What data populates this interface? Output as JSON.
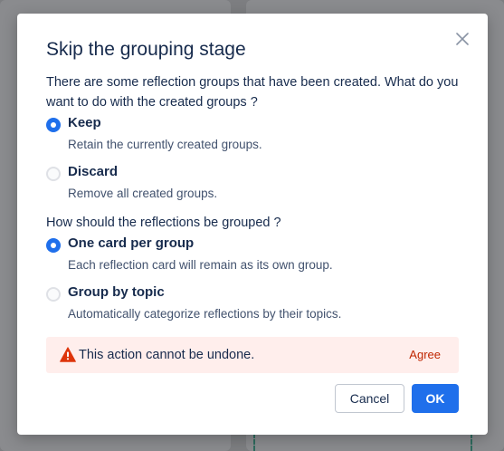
{
  "dialog": {
    "title": "Skip the grouping stage",
    "close_icon": "close-icon"
  },
  "question1": {
    "text": "There are some reflection groups that have been created. What do you want to do with the created groups ?",
    "options": [
      {
        "label": "Keep",
        "description": "Retain the currently created groups.",
        "selected": true
      },
      {
        "label": "Discard",
        "description": "Remove all created groups.",
        "selected": false
      }
    ]
  },
  "question2": {
    "text": "How should the reflections be grouped ?",
    "options": [
      {
        "label": "One card per group",
        "description": "Each reflection card will remain as its own group.",
        "selected": true
      },
      {
        "label": "Group by topic",
        "description": "Automatically categorize reflections by their topics.",
        "selected": false
      }
    ]
  },
  "warning": {
    "icon": "warning-icon",
    "text": "This action cannot be undone.",
    "agree_label": "Agree",
    "color": "#bf2600"
  },
  "buttons": {
    "cancel_label": "Cancel",
    "ok_label": "OK"
  },
  "colors": {
    "accent": "#1f6feb",
    "warning_bg": "#ffeeec"
  }
}
